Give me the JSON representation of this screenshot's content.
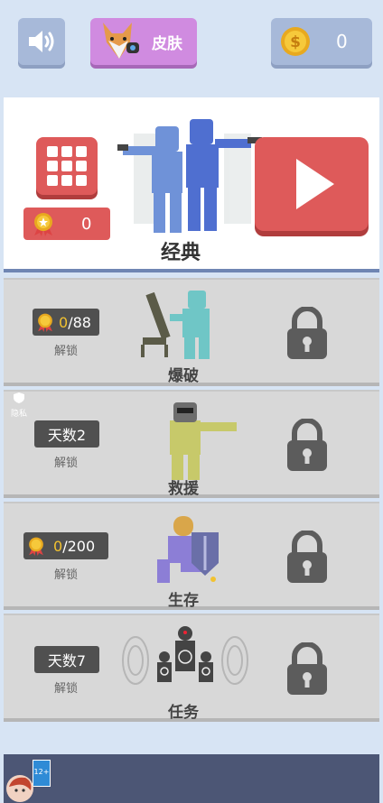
{
  "topbar": {
    "sound_icon": "speaker-icon",
    "skin_label": "皮肤",
    "coins": "0"
  },
  "classic": {
    "medals": "0",
    "title": "经典"
  },
  "modes": [
    {
      "id": "demolition",
      "title": "爆破",
      "req_current": "0",
      "req_total": "/88",
      "unlock_label": "解锁",
      "requirement_type": "medal"
    },
    {
      "id": "rescue",
      "title": "救援",
      "req_text": "天数2",
      "unlock_label": "解锁",
      "requirement_type": "days"
    },
    {
      "id": "survival",
      "title": "生存",
      "req_current": "0",
      "req_total": "/200",
      "unlock_label": "解锁",
      "requirement_type": "medal"
    },
    {
      "id": "mission",
      "title": "任务",
      "req_text": "天数7",
      "unlock_label": "解锁",
      "requirement_type": "days"
    }
  ],
  "privacy_label": "隐私",
  "age_rating": "12+",
  "colors": {
    "accent_red": "#de5a5a",
    "skin_purple": "#d08be0",
    "button_blue": "#a7b9d9",
    "gold": "#f2c230"
  }
}
